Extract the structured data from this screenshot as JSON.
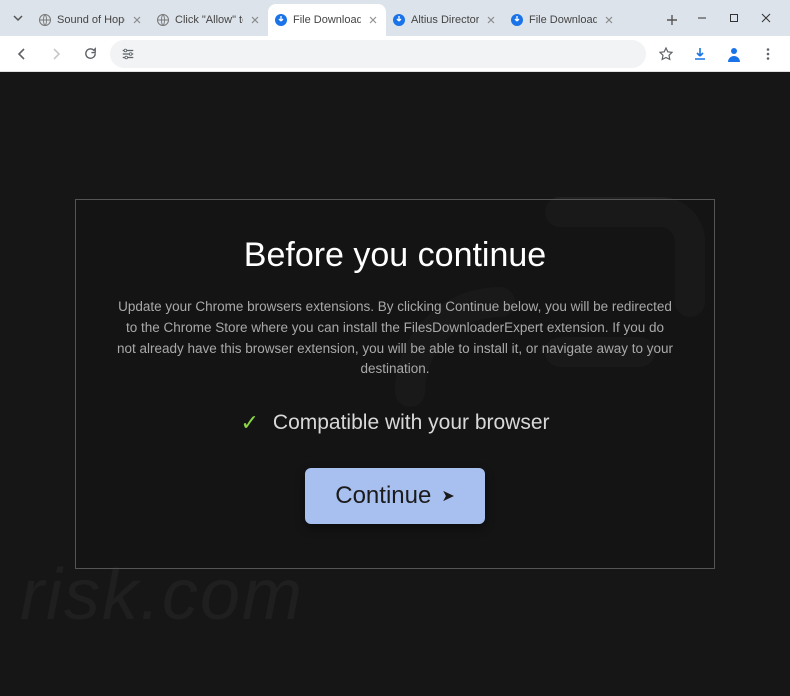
{
  "tabs": [
    {
      "title": "Sound of Hope: Th",
      "active": false,
      "favicon": "globe"
    },
    {
      "title": "Click \"Allow\" to re",
      "active": false,
      "favicon": "globe"
    },
    {
      "title": "File Download",
      "active": true,
      "favicon": "download"
    },
    {
      "title": "Altius Directory |",
      "active": false,
      "favicon": "download"
    },
    {
      "title": "File Download",
      "active": false,
      "favicon": "download"
    }
  ],
  "modal": {
    "heading": "Before you continue",
    "description": "Update your Chrome browsers extensions. By clicking Continue below, you will be redirected to the Chrome Store where you can install the FilesDownloaderExpert extension. If you do not already have this browser extension, you will be able to install it, or navigate away to your destination.",
    "compat_text": "Compatible with your browser",
    "button_label": "Continue"
  },
  "watermark": {
    "text": "risk.com"
  }
}
